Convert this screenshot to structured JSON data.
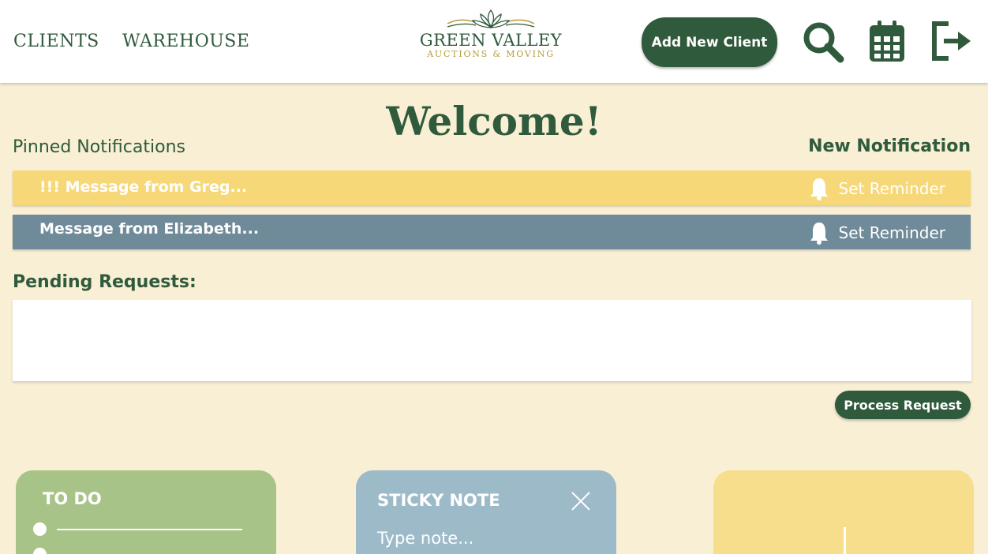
{
  "header": {
    "nav": [
      "CLIENTS",
      "WAREHOUSE"
    ],
    "logo_main": "GREEN VALLEY",
    "logo_sub": "AUCTIONS & MOVING",
    "add_client_label": "Add New Client",
    "icons": [
      "search-icon",
      "calendar-icon",
      "logout-icon"
    ]
  },
  "main": {
    "welcome": "Welcome!",
    "pinned_label": "Pinned Notifications",
    "new_notification": "New Notification",
    "notifications": [
      {
        "text": "!!! Message from Greg...",
        "reminder": "Set Reminder",
        "color": "#f7d878"
      },
      {
        "text": "Message from Elizabeth...",
        "reminder": "Set Reminder",
        "color": "#6f8a99"
      }
    ],
    "pending_label": "Pending Requests:",
    "process_label": "Process Request"
  },
  "cards": {
    "todo_title": "TO DO",
    "sticky_title": "STICKY NOTE",
    "sticky_placeholder": "Type note..."
  },
  "colors": {
    "brand_green": "#2f5a3b",
    "background": "#f8efd5",
    "logo_gold": "#b79a3a"
  }
}
